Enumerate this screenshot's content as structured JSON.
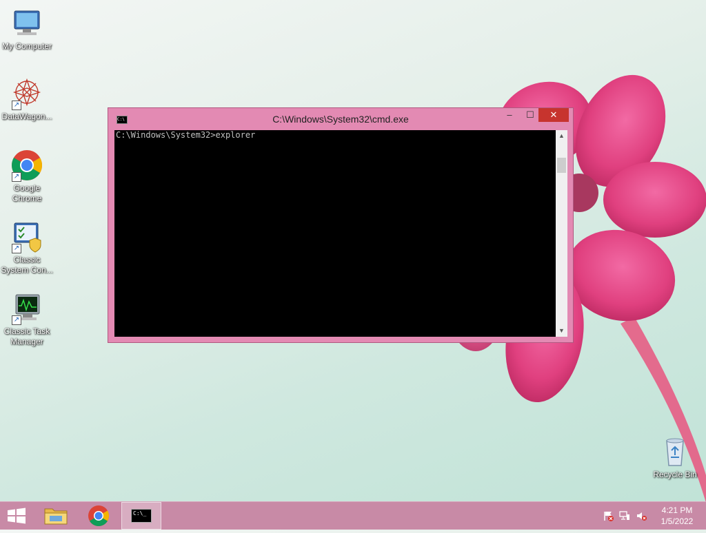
{
  "desktop": {
    "icons": [
      {
        "label": "My Computer"
      },
      {
        "label": "DataWagon..."
      },
      {
        "label": "Google Chrome"
      },
      {
        "label": "Classic System Con..."
      },
      {
        "label": "Classic Task Manager"
      }
    ],
    "recycle_bin": {
      "label": "Recycle Bin"
    }
  },
  "window": {
    "title": "C:\\Windows\\System32\\cmd.exe",
    "icon_text": "C:\\",
    "minimize": "–",
    "maximize": "☐",
    "close": "✕",
    "console_line": "C:\\Windows\\System32>explorer"
  },
  "taskbar": {
    "items": [
      "start",
      "file-explorer",
      "google-chrome",
      "command-prompt"
    ],
    "active": "command-prompt",
    "cmd_icon_text": "C:\\_",
    "clock": {
      "time": "4:21 PM",
      "date": "1/5/2022"
    }
  },
  "colors": {
    "window_frame": "#e38ab3",
    "close_button": "#c7342e",
    "taskbar": "#c88aa6"
  }
}
